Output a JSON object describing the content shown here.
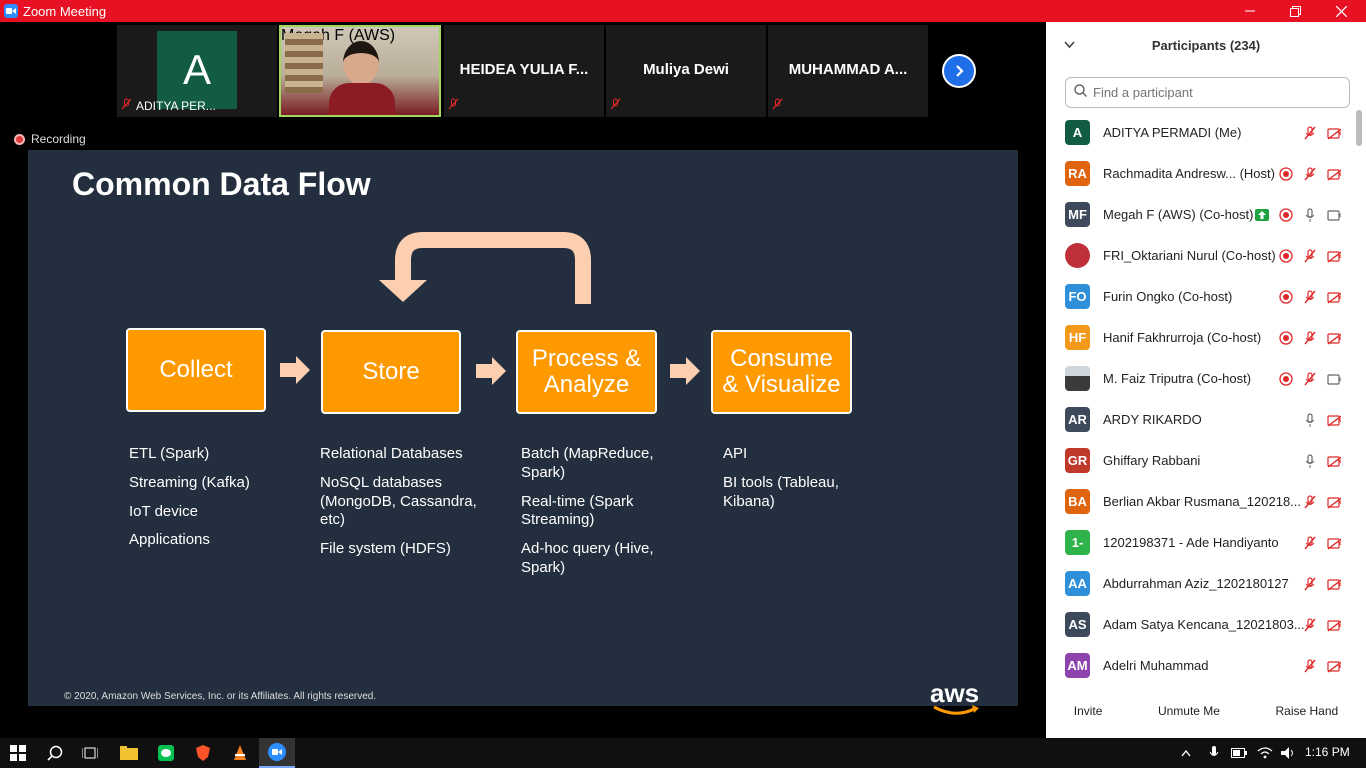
{
  "window": {
    "title": "Zoom Meeting"
  },
  "gallery": {
    "tiles": [
      {
        "name": "ADITYA PER...",
        "avatar_letter": "A"
      },
      {
        "name": "Megah F (AWS)"
      },
      {
        "name": "HEIDEA YULIA F..."
      },
      {
        "name": "Muliya Dewi"
      },
      {
        "name": "MUHAMMAD A..."
      }
    ]
  },
  "recording": {
    "label": "Recording"
  },
  "slide": {
    "title": "Common Data Flow",
    "steps": [
      {
        "label_line1": "Collect",
        "label_line2": ""
      },
      {
        "label_line1": "Store",
        "label_line2": ""
      },
      {
        "label_line1": "Process &",
        "label_line2": "Analyze"
      },
      {
        "label_line1": "Consume",
        "label_line2": "& Visualize"
      }
    ],
    "lists": [
      [
        "ETL (Spark)",
        "Streaming (Kafka)",
        "IoT device",
        "Applications"
      ],
      [
        "Relational Databases",
        "NoSQL databases (MongoDB, Cassandra, etc)",
        "File system (HDFS)"
      ],
      [
        "Batch (MapReduce, Spark)",
        "Real-time (Spark Streaming)",
        "Ad-hoc query (Hive, Spark)"
      ],
      [
        "API",
        "BI tools (Tableau, Kibana)"
      ]
    ],
    "copyright": "© 2020, Amazon Web Services, Inc. or its Affiliates. All rights reserved.",
    "logo_text": "aws",
    "colors": {
      "background": "#232f3e",
      "box": "#ff9900",
      "arrow": "#fccfb0"
    }
  },
  "participants": {
    "header": "Participants (234)",
    "search_placeholder": "Find a participant",
    "list": [
      {
        "initials": "A",
        "name": "ADITYA PERMADI (Me)",
        "color": "#125c46"
      },
      {
        "initials": "RA",
        "name": "Rachmadita Andresw... (Host)",
        "color": "#e0640e"
      },
      {
        "initials": "MF",
        "name": "Megah F (AWS) (Co-host)",
        "color": "#3d4a5c"
      },
      {
        "initials": "",
        "name": "FRI_Oktariani Nurul (Co-host)",
        "color": "#c0303a"
      },
      {
        "initials": "FO",
        "name": "Furin Ongko (Co-host)",
        "color": "#2f8fd8"
      },
      {
        "initials": "HF",
        "name": "Hanif Fakhrurroja (Co-host)",
        "color": "#f39a1a"
      },
      {
        "initials": "",
        "name": "M. Faiz Triputra (Co-host)",
        "color": "#4a4a4a"
      },
      {
        "initials": "AR",
        "name": "ARDY RIKARDO",
        "color": "#3d4a5c"
      },
      {
        "initials": "GR",
        "name": "Ghiffary Rabbani",
        "color": "#c0392b"
      },
      {
        "initials": "BA",
        "name": " Berlian Akbar Rusmana_120218...",
        "color": "#e0640e"
      },
      {
        "initials": "1-",
        "name": "1202198371 - Ade Handiyanto",
        "color": "#2eb24a"
      },
      {
        "initials": "AA",
        "name": "Abdurrahman Aziz_1202180127",
        "color": "#2f8fd8"
      },
      {
        "initials": "AS",
        "name": "Adam Satya Kencana_12021803...",
        "color": "#3d4a5c"
      },
      {
        "initials": "AM",
        "name": "Adelri Muhammad",
        "color": "#8e44ad"
      }
    ],
    "buttons": {
      "invite": "Invite",
      "unmute": "Unmute Me",
      "raise_hand": "Raise Hand"
    }
  },
  "taskbar": {
    "time": "1:16 PM"
  }
}
